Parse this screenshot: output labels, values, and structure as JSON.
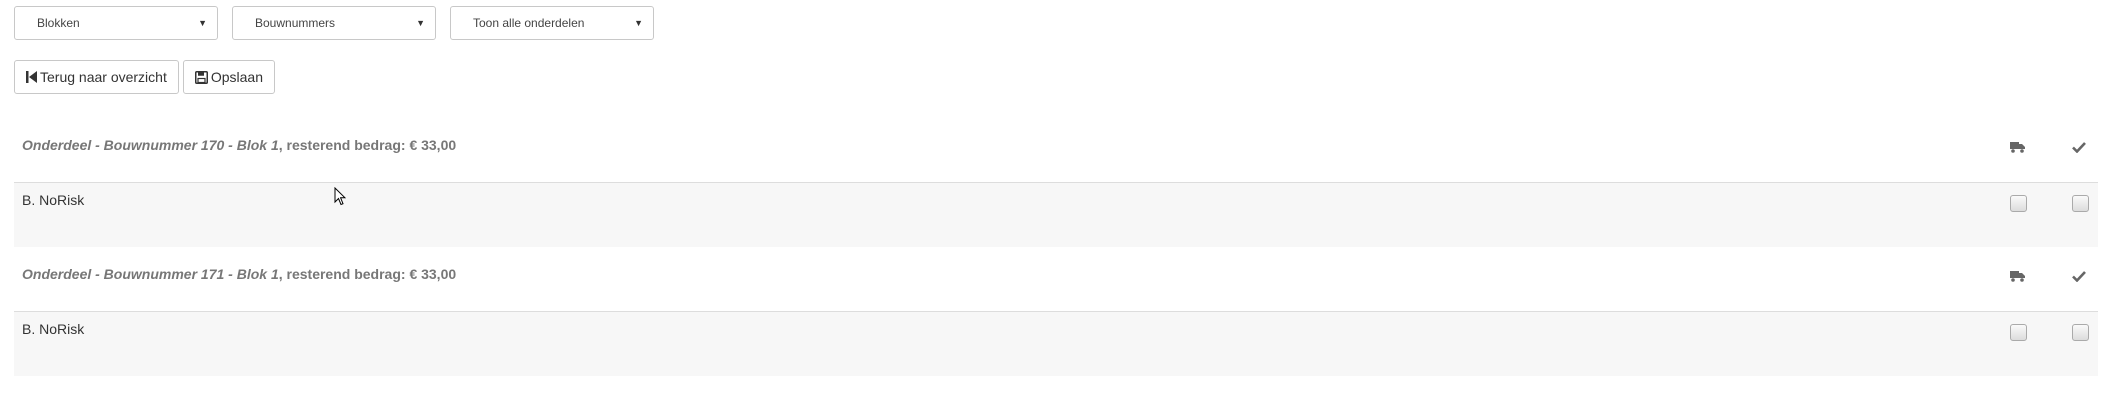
{
  "filters": {
    "blokken": "Blokken",
    "bouwnummers": "Bouwnummers",
    "onderdelen": "Toon alle onderdelen"
  },
  "toolbar": {
    "back_label": "Terug naar overzicht",
    "save_label": "Opslaan"
  },
  "groups": [
    {
      "title_italic": "Onderdeel - Bouwnummer 170 - Blok 1",
      "title_rest": ", resterend bedrag: € 33,00",
      "rows": [
        {
          "name": "B. NoRisk"
        }
      ]
    },
    {
      "title_italic": "Onderdeel - Bouwnummer 171 - Blok 1",
      "title_rest": ", resterend bedrag: € 33,00",
      "rows": [
        {
          "name": "B. NoRisk"
        }
      ]
    }
  ],
  "icons": {
    "header_columns": [
      "truck-icon",
      "check-icon"
    ],
    "select_arrow": "caret-down-icon"
  },
  "colors": {
    "row_background": "#f7f7f7",
    "header_text": "#777777",
    "border": "#dddddd"
  }
}
